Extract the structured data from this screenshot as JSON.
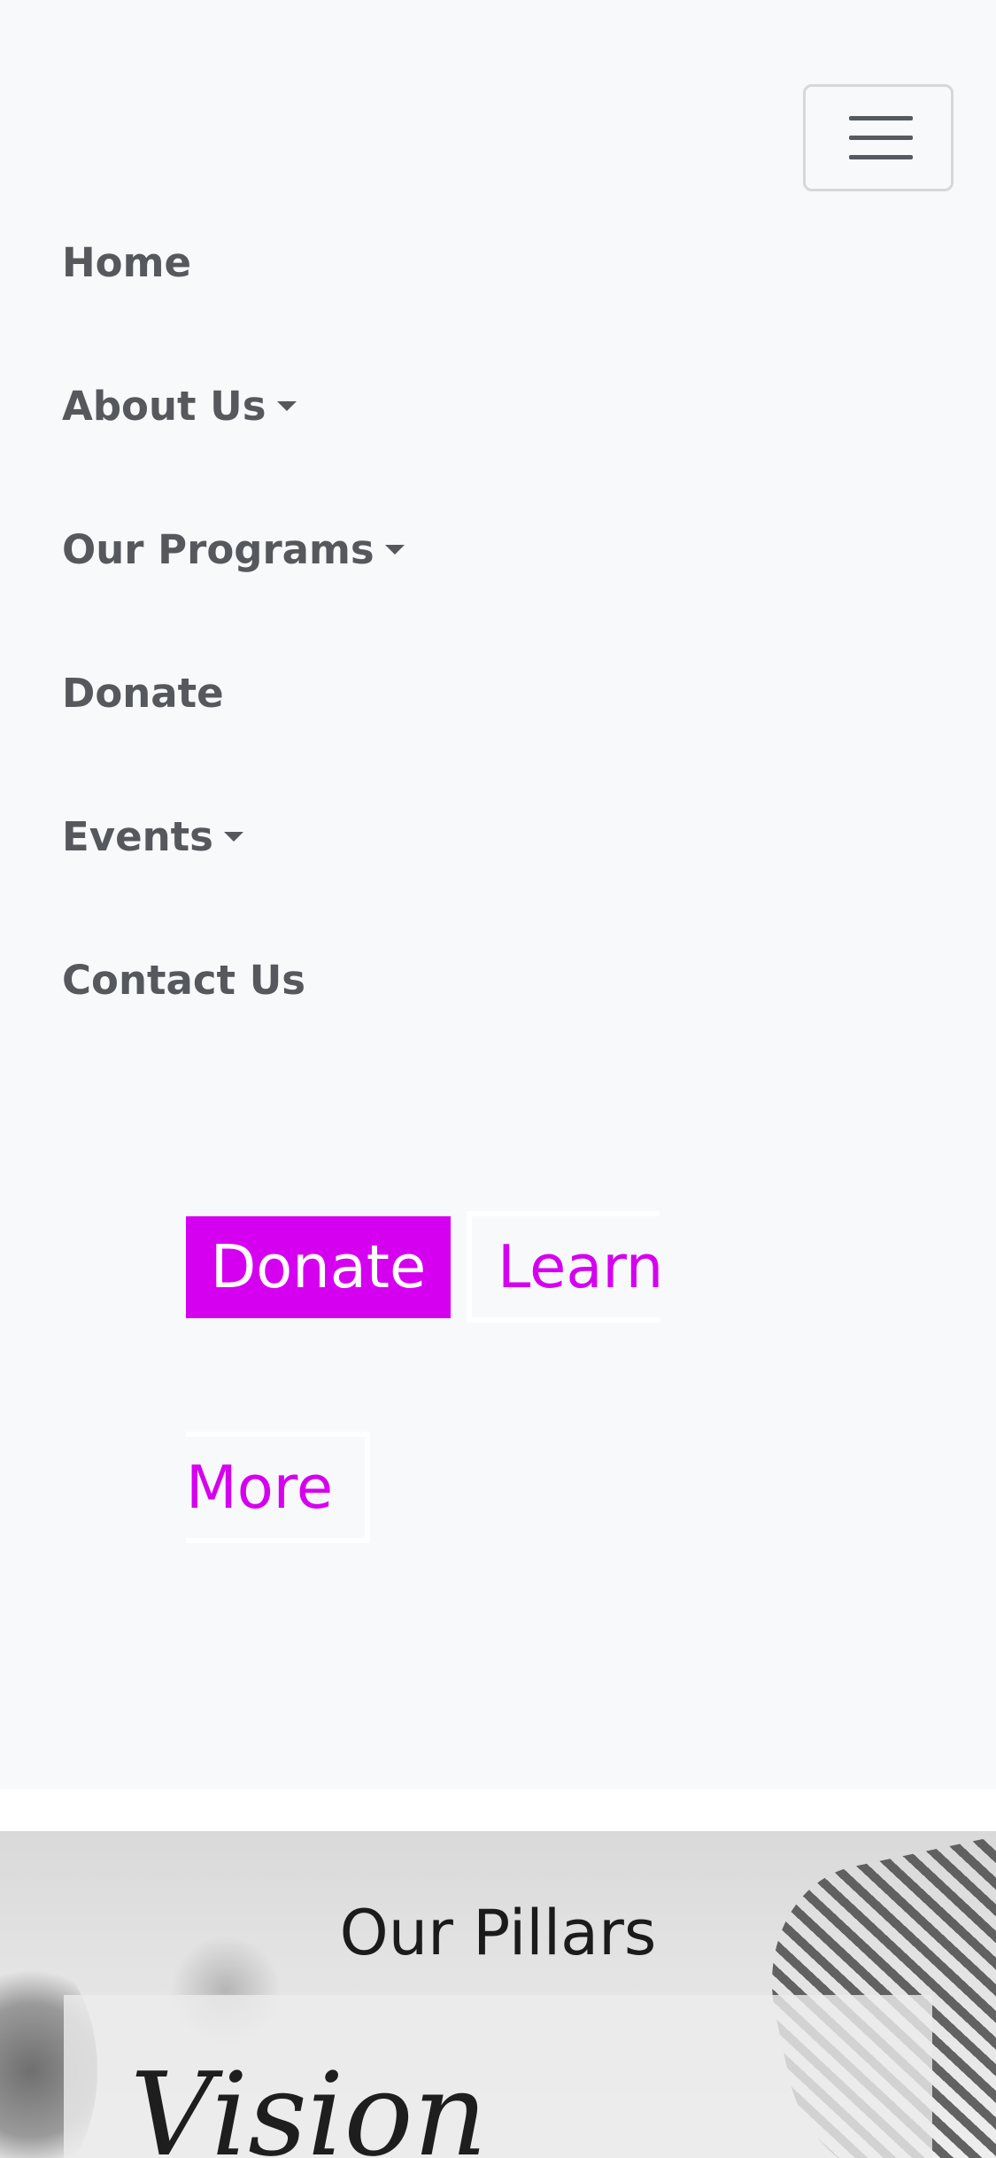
{
  "nav": {
    "items": [
      {
        "label": "Home",
        "dropdown": false
      },
      {
        "label": "About Us",
        "dropdown": true
      },
      {
        "label": "Our Programs",
        "dropdown": true
      },
      {
        "label": "Donate",
        "dropdown": false
      },
      {
        "label": "Events",
        "dropdown": true
      },
      {
        "label": "Contact Us",
        "dropdown": false
      }
    ],
    "toggler_icon": "hamburger-menu-icon"
  },
  "hero": {
    "donate_label": "Donate",
    "learn_line1": "Learn",
    "learn_line2": "More"
  },
  "pillars": {
    "title": "Our Pillars",
    "card_title": "Vision"
  },
  "colors": {
    "accent": "#d600f0",
    "nav_text": "#55585c",
    "background": "#f8f9fb"
  }
}
